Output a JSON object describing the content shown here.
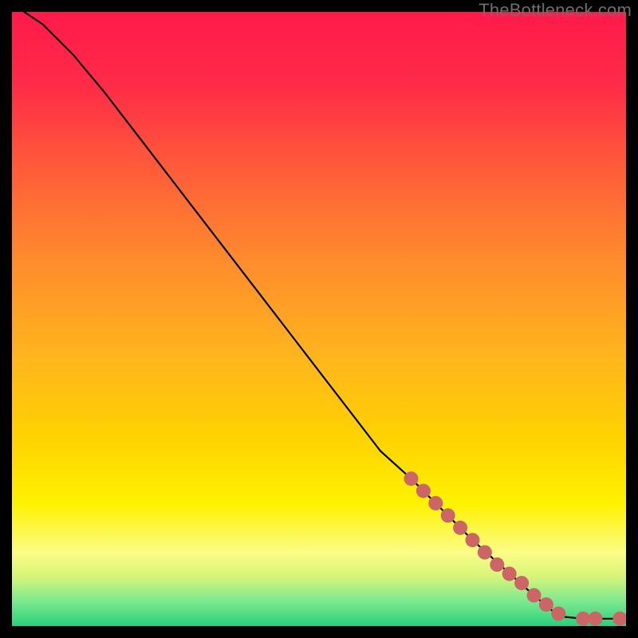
{
  "watermark": "TheBottleneck.com",
  "chart_data": {
    "type": "line",
    "title": "",
    "xlabel": "",
    "ylabel": "",
    "xlim": [
      0,
      100
    ],
    "ylim": [
      0,
      100
    ],
    "grid": false,
    "legend": false,
    "gradient_stops": [
      {
        "offset": 0.0,
        "color": "#ff1a4b"
      },
      {
        "offset": 0.12,
        "color": "#ff2b47"
      },
      {
        "offset": 0.25,
        "color": "#ff5a3a"
      },
      {
        "offset": 0.4,
        "color": "#ff8a2e"
      },
      {
        "offset": 0.55,
        "color": "#ffb21f"
      },
      {
        "offset": 0.7,
        "color": "#ffd400"
      },
      {
        "offset": 0.8,
        "color": "#fff200"
      },
      {
        "offset": 0.88,
        "color": "#fbfd86"
      },
      {
        "offset": 0.92,
        "color": "#d6f47a"
      },
      {
        "offset": 0.96,
        "color": "#7de88f"
      },
      {
        "offset": 1.0,
        "color": "#28d17c"
      }
    ],
    "curve": [
      {
        "x": 2,
        "y": 100
      },
      {
        "x": 5,
        "y": 98
      },
      {
        "x": 10,
        "y": 93
      },
      {
        "x": 15,
        "y": 87
      },
      {
        "x": 20,
        "y": 80.5
      },
      {
        "x": 30,
        "y": 67.5
      },
      {
        "x": 40,
        "y": 54.5
      },
      {
        "x": 50,
        "y": 41.5
      },
      {
        "x": 60,
        "y": 28.5
      },
      {
        "x": 65,
        "y": 24
      },
      {
        "x": 70,
        "y": 19
      },
      {
        "x": 75,
        "y": 14
      },
      {
        "x": 80,
        "y": 9.5
      },
      {
        "x": 85,
        "y": 5
      },
      {
        "x": 88,
        "y": 2.5
      },
      {
        "x": 90,
        "y": 1.5
      },
      {
        "x": 93,
        "y": 1.2
      },
      {
        "x": 96,
        "y": 1.2
      },
      {
        "x": 99,
        "y": 1.2
      }
    ],
    "dots": [
      {
        "x": 65,
        "y": 24
      },
      {
        "x": 67,
        "y": 22
      },
      {
        "x": 69,
        "y": 20
      },
      {
        "x": 71,
        "y": 18
      },
      {
        "x": 73,
        "y": 16
      },
      {
        "x": 75,
        "y": 14
      },
      {
        "x": 77,
        "y": 12
      },
      {
        "x": 79,
        "y": 10
      },
      {
        "x": 81,
        "y": 8.5
      },
      {
        "x": 83,
        "y": 7
      },
      {
        "x": 85,
        "y": 5
      },
      {
        "x": 87,
        "y": 3.5
      },
      {
        "x": 89,
        "y": 2
      },
      {
        "x": 93,
        "y": 1.2
      },
      {
        "x": 95,
        "y": 1.2
      },
      {
        "x": 99,
        "y": 1.2
      }
    ],
    "curve_color": "#000000",
    "dot_color": "#cc6666",
    "dot_radius": 9
  }
}
